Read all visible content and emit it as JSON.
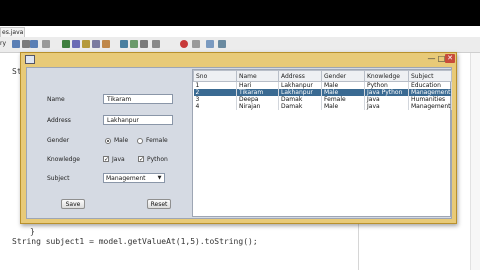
{
  "ide": {
    "tab_label": "es.java",
    "tab_close": "×",
    "toolbar_label": "ry",
    "code_prefix": "Str",
    "code_brace": "}",
    "code_bottom": "String subject1 = model.getValueAt(1,5).toString();",
    "toolbar_colors": [
      "#5a7fb5",
      "#7a7a7a",
      "#5a7fb5",
      "#999999",
      "#3f7f3f",
      "#6b6bb5",
      "#b59a3a",
      "#7a7aa0",
      "#c0884a",
      "#4a7fa0",
      "#6a9a6a",
      "#7a7a7a",
      "#8a8a8a",
      "#c83a3a",
      "#9a9a9a",
      "#7a9ac0",
      "#6a8aa0"
    ]
  },
  "window": {
    "minimize": "—",
    "maximize": "□",
    "close": "✕"
  },
  "form": {
    "name_label": "Name",
    "name_value": "Tikaram",
    "address_label": "Address",
    "address_value": "Lakhanpur",
    "gender_label": "Gender",
    "gender_male": "Male",
    "gender_female": "Female",
    "knowledge_label": "Knowledge",
    "knowledge_java": "Java",
    "knowledge_python": "Python",
    "subject_label": "Subject",
    "subject_value": "Management",
    "save_label": "Save",
    "reset_label": "Reset"
  },
  "table": {
    "headers": [
      "Sno",
      "Name",
      "Address",
      "Gender",
      "Knowledge",
      "Subject"
    ],
    "rows": [
      [
        "1",
        "Hari",
        "Lakhanpur",
        "Male",
        "Python",
        "Education"
      ],
      [
        "2",
        "Tikaram",
        "Lakhanpur",
        "Male",
        "Java Python",
        "Management"
      ],
      [
        "3",
        "Deepa",
        "Damak",
        "Female",
        "Java",
        "Humanities"
      ],
      [
        "4",
        "Nirajan",
        "Damak",
        "Male",
        "Java",
        "Management"
      ]
    ],
    "selected_row": 1
  }
}
